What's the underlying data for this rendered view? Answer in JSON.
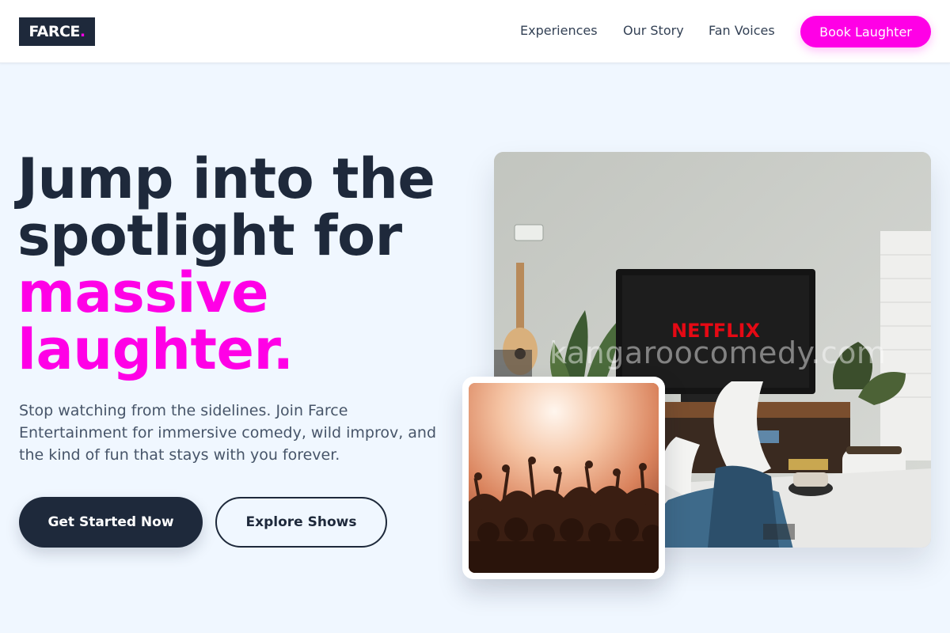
{
  "brand": {
    "name": "FARCE",
    "dot": ".",
    "accent_color": "#ff00e6",
    "dark_color": "#1e293b"
  },
  "nav": {
    "items": [
      {
        "label": "Experiences"
      },
      {
        "label": "Our Story"
      },
      {
        "label": "Fan Voices"
      }
    ],
    "cta_label": "Book Laughter"
  },
  "hero": {
    "headline_line1": "Jump into the",
    "headline_line2": "spotlight for",
    "headline_accent_line1": "massive",
    "headline_accent_line2": "laughter.",
    "subtext": "Stop watching from the sidelines. Join Farce Entertainment for immersive comedy, wild improv, and the kind of fun that stays with you forever.",
    "primary_button": "Get Started Now",
    "secondary_button": "Explore Shows"
  },
  "images": {
    "main": {
      "tv_text": "NETFLIX",
      "watermark": "kangaroocomedy.com"
    },
    "small": {
      "subject": "concert crowd"
    }
  }
}
